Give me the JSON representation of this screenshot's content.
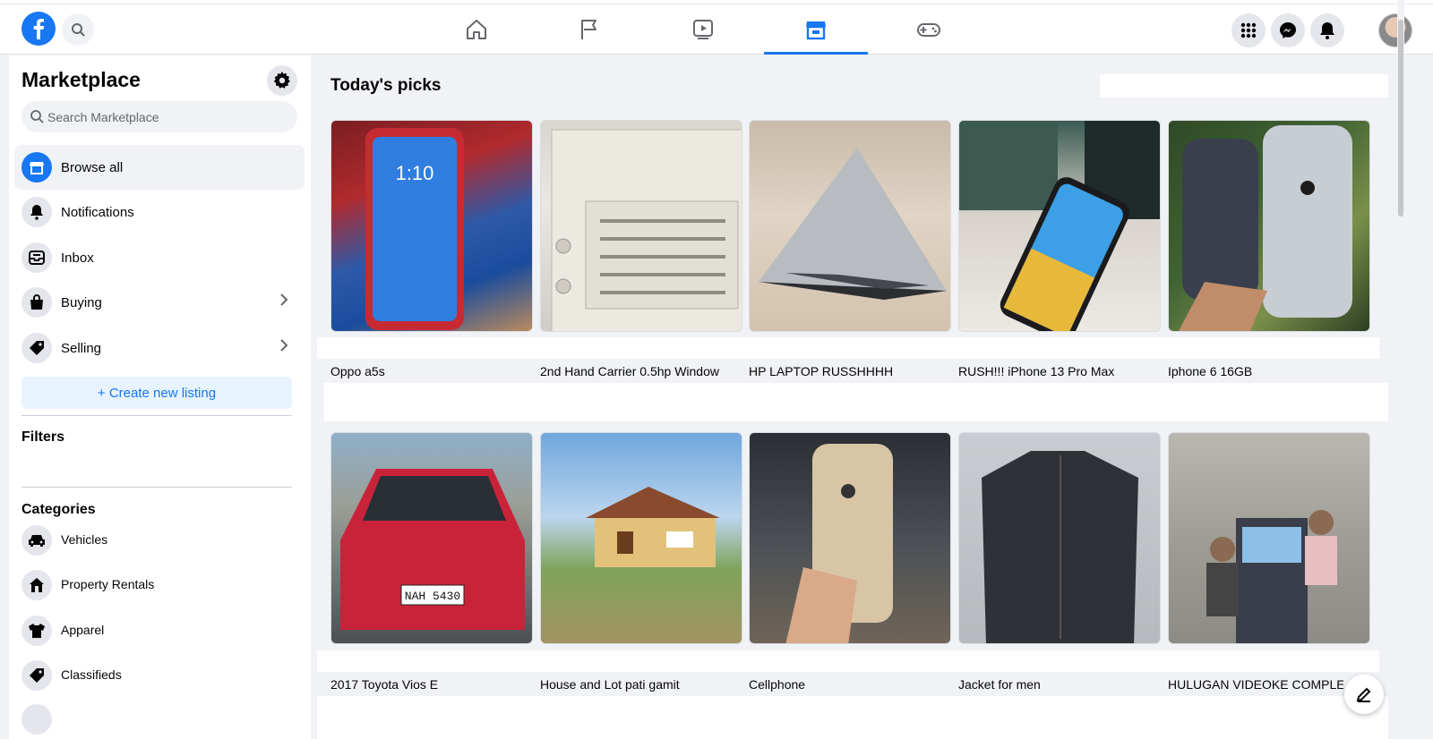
{
  "app": {
    "name": "Facebook"
  },
  "topnav": {
    "tabs": [
      "home",
      "pages",
      "watch",
      "marketplace",
      "gaming"
    ],
    "active_tab": "marketplace",
    "accent_color": "#1877f2"
  },
  "sidebar": {
    "title": "Marketplace",
    "search_placeholder": "Search Marketplace",
    "menu": [
      {
        "label": "Browse all",
        "icon": "storefront-icon",
        "active": true
      },
      {
        "label": "Notifications",
        "icon": "bell-icon"
      },
      {
        "label": "Inbox",
        "icon": "inbox-icon"
      },
      {
        "label": "Buying",
        "icon": "shopping-bag-icon",
        "chevron": true
      },
      {
        "label": "Selling",
        "icon": "tag-icon",
        "chevron": true
      }
    ],
    "create_listing_label": "+ Create new listing",
    "filters_heading": "Filters",
    "categories_heading": "Categories",
    "categories": [
      {
        "label": "Vehicles",
        "icon": "car-icon"
      },
      {
        "label": "Property Rentals",
        "icon": "house-icon"
      },
      {
        "label": "Apparel",
        "icon": "shirt-icon"
      },
      {
        "label": "Classifieds",
        "icon": "tag-icon"
      }
    ]
  },
  "main": {
    "section_title": "Today's picks",
    "listings_row1": [
      {
        "title": "Oppo a5s",
        "image": "phone-photo"
      },
      {
        "title": "2nd Hand Carrier 0.5hp Window",
        "image": "aircon-photo"
      },
      {
        "title": "HP LAPTOP RUSSHHHH",
        "image": "laptop-photo"
      },
      {
        "title": "RUSH!!! iPhone 13 Pro Max",
        "image": "iphone-photo"
      },
      {
        "title": "Iphone 6 16GB",
        "image": "iphone6-photo"
      }
    ],
    "listings_row2": [
      {
        "title": "2017 Toyota Vios E",
        "image": "car-photo"
      },
      {
        "title": "House and Lot pati gamit",
        "image": "house-photo"
      },
      {
        "title": "Cellphone",
        "image": "gold-iphone-photo"
      },
      {
        "title": "Jacket for men",
        "image": "jacket-photo"
      },
      {
        "title": "HULUGAN VIDEOKE COMPLETE",
        "image": "videoke-photo"
      }
    ]
  }
}
